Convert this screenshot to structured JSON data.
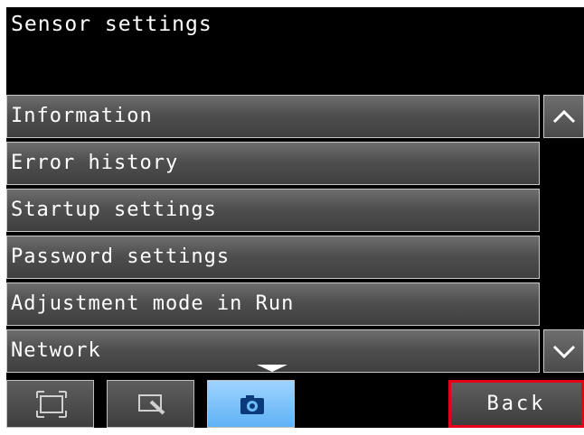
{
  "title": "Sensor settings",
  "menu": {
    "items": [
      {
        "label": "Information"
      },
      {
        "label": "Error history"
      },
      {
        "label": "Startup settings"
      },
      {
        "label": "Password settings"
      },
      {
        "label": "Adjustment mode in Run"
      },
      {
        "label": "Network"
      }
    ]
  },
  "scrollbar": {
    "up_icon": "chevron-up-icon",
    "down_icon": "chevron-down-icon"
  },
  "toolbar": {
    "buttons": [
      {
        "icon": "frame-icon",
        "active": false
      },
      {
        "icon": "zoom-region-icon",
        "active": false
      },
      {
        "icon": "camera-icon",
        "active": true
      }
    ],
    "back_label": "Back"
  },
  "colors": {
    "background": "#000000",
    "text": "#ffffff",
    "active_button": "#6cbcf8",
    "back_border": "#e8001a"
  }
}
